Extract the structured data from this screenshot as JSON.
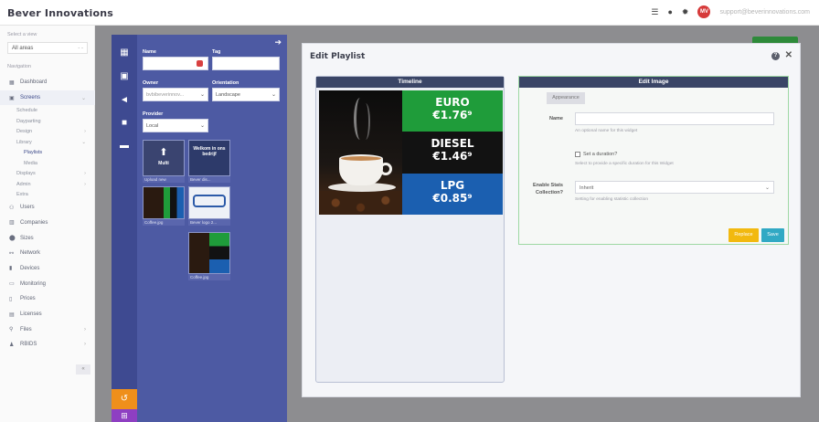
{
  "app": {
    "title": "Bever Innovations"
  },
  "topbar": {
    "user_initials": "MV",
    "user_email": "support@beverinnovations.com"
  },
  "sidebar": {
    "select_label": "Select a view",
    "select_value": "All areas",
    "select_extra": "- -",
    "nav_label": "Navigation",
    "items": [
      {
        "label": "Dashboard",
        "icon": "dashboard-icon",
        "glyph": "▦"
      },
      {
        "label": "Screens",
        "icon": "screens-icon",
        "glyph": "▣",
        "chevron": "⌄"
      },
      {
        "label": "Users",
        "icon": "users-icon",
        "glyph": "⚇"
      },
      {
        "label": "Companies",
        "icon": "companies-icon",
        "glyph": "▥"
      },
      {
        "label": "Sizes",
        "icon": "sizes-icon",
        "glyph": "⬤"
      },
      {
        "label": "Network",
        "icon": "network-icon",
        "glyph": "⚯"
      },
      {
        "label": "Devices",
        "icon": "devices-icon",
        "glyph": "▮"
      },
      {
        "label": "Monitoring",
        "icon": "monitoring-icon",
        "glyph": "▭"
      },
      {
        "label": "Prices",
        "icon": "prices-icon",
        "glyph": "▯"
      },
      {
        "label": "Licenses",
        "icon": "licenses-icon",
        "glyph": "▤"
      },
      {
        "label": "Files",
        "icon": "files-icon",
        "glyph": "⚲",
        "chevron": "›"
      },
      {
        "label": "RBIDS",
        "icon": "rbids-icon",
        "glyph": "♟",
        "chevron": "›"
      }
    ],
    "screens_sub": [
      {
        "label": "Schedule"
      },
      {
        "label": "Dayparting"
      },
      {
        "label": "Design",
        "chevron": "›"
      },
      {
        "label": "Library",
        "chevron": "⌄"
      },
      {
        "label": "Playlists",
        "level": 2
      },
      {
        "label": "Media",
        "level": 2
      },
      {
        "label": "Displays",
        "chevron": "›"
      },
      {
        "label": "Admin",
        "chevron": "›"
      },
      {
        "label": "Extra"
      }
    ],
    "collapse": "«"
  },
  "library_panel": {
    "name_label": "Name",
    "tag_label": "Tag",
    "owner_label": "Owner",
    "owner_value": "bvbibeverinnov...",
    "orientation_label": "Orientation",
    "orientation_value": "Landscape",
    "provider_label": "Provider",
    "provider_value": "Local",
    "tiles": [
      {
        "caption": "Upload new",
        "icon_text": "Multi"
      },
      {
        "caption": "Bever dis...",
        "text": "Welkom in ons bedrijf"
      },
      {
        "caption": "Coffee.jpg"
      },
      {
        "caption": "Bever logo 2..."
      },
      {
        "caption": "Coffee.jpg"
      }
    ]
  },
  "modal": {
    "title": "Edit Playlist",
    "timeline": {
      "heading": "Timeline"
    },
    "board": [
      {
        "fuel": "EURO",
        "price": "€1.76⁹",
        "color": "#1f9c3a"
      },
      {
        "fuel": "DIESEL",
        "price": "€1.46⁹",
        "color": "#121212"
      },
      {
        "fuel": "LPG",
        "price": "€0.85⁹",
        "color": "#1b5fb0"
      }
    ],
    "edit_image": {
      "heading": "Edit Image",
      "tab": "Appearance",
      "name_label": "Name",
      "name_help": "An optional name for this widget",
      "duration_label": "Set a duration?",
      "duration_help": "Select to provide a specific duration for this Widget",
      "stats_label": "Enable Stats Collection?",
      "stats_value": "Inherit",
      "stats_help": "Setting for enabling statistic collection",
      "replace_label": "Replace",
      "save_label": "Save"
    }
  }
}
